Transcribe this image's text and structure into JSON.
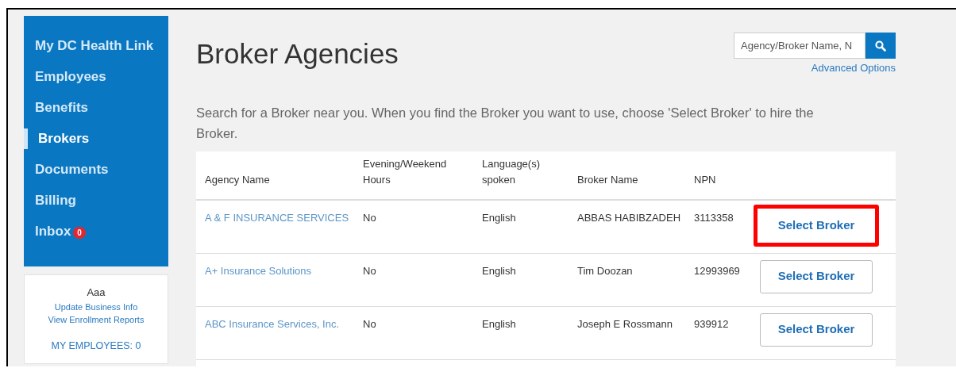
{
  "sidebar": {
    "items": [
      {
        "label": "My DC Health Link",
        "selected": false
      },
      {
        "label": "Employees",
        "selected": false
      },
      {
        "label": "Benefits",
        "selected": false
      },
      {
        "label": "Brokers",
        "selected": true
      },
      {
        "label": "Documents",
        "selected": false
      },
      {
        "label": "Billing",
        "selected": false
      },
      {
        "label": "Inbox",
        "selected": false,
        "badge": "0"
      }
    ]
  },
  "employer_card": {
    "name": "Aaa",
    "links": [
      "Update Business Info",
      "View Enrollment Reports"
    ],
    "employees": "MY EMPLOYEES: 0"
  },
  "title": "Broker Agencies",
  "search": {
    "placeholder": "Agency/Broker Name, N",
    "advanced_link": "Advanced Options"
  },
  "intro": "Search for a Broker near you. When you find the Broker you want to use, choose 'Select Broker' to hire the Broker.",
  "table": {
    "columns": [
      "Agency Name",
      "Evening/Weekend Hours",
      "Language(s) spoken",
      "Broker Name",
      "NPN"
    ],
    "rows": [
      {
        "agency": "A & F INSURANCE SERVICES",
        "hours": "No",
        "language": "English",
        "broker": "ABBAS HABIBZADEH",
        "npn": "3113358",
        "button": "Select Broker",
        "highlighted": true
      },
      {
        "agency": "A+ Insurance Solutions",
        "hours": "No",
        "language": "English",
        "broker": "Tim Doozan",
        "npn": "12993969",
        "button": "Select Broker",
        "highlighted": false
      },
      {
        "agency": "ABC Insurance Services, Inc.",
        "hours": "No",
        "language": "English",
        "broker": "Joseph E Rossmann",
        "npn": "939912",
        "button": "Select Broker",
        "highlighted": false
      }
    ]
  }
}
